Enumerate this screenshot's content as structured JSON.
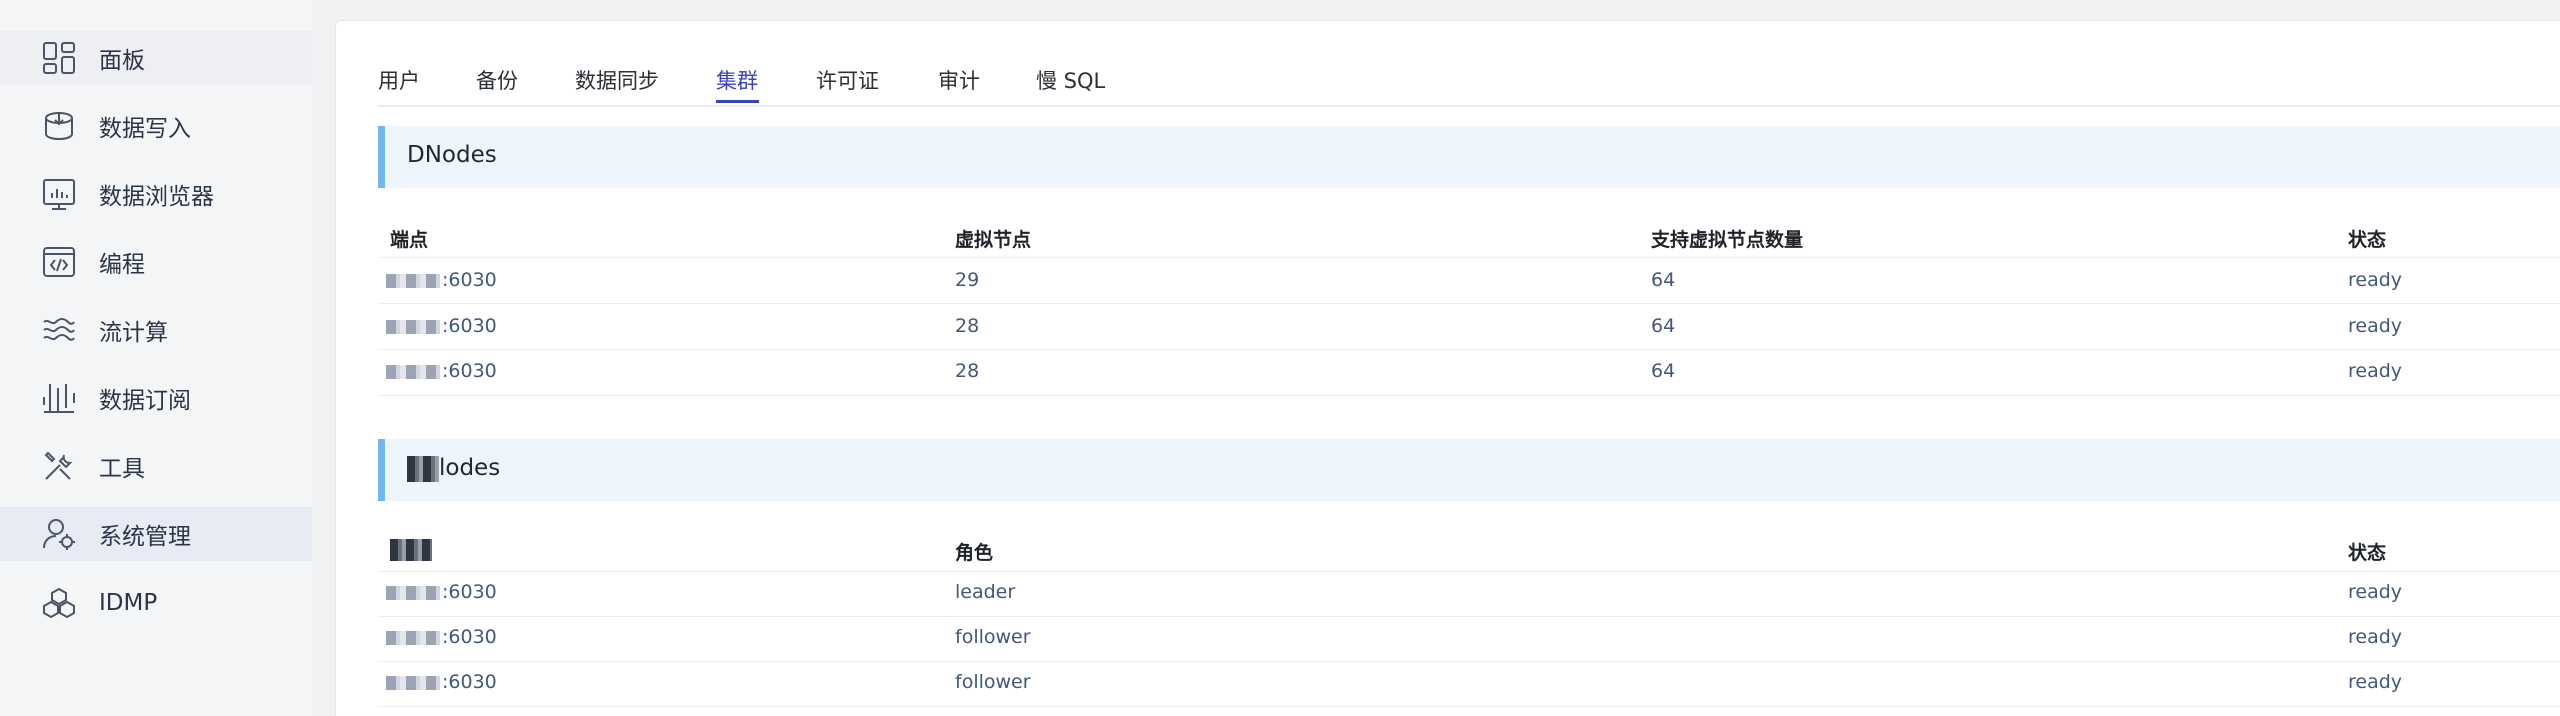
{
  "sidebar": {
    "items": [
      {
        "label": "面板",
        "icon": "dashboard-icon"
      },
      {
        "label": "数据写入",
        "icon": "data-ingest-icon"
      },
      {
        "label": "数据浏览器",
        "icon": "data-browser-icon"
      },
      {
        "label": "编程",
        "icon": "code-icon"
      },
      {
        "label": "流计算",
        "icon": "stream-icon"
      },
      {
        "label": "数据订阅",
        "icon": "subscribe-icon"
      },
      {
        "label": "工具",
        "icon": "tools-icon"
      },
      {
        "label": "系统管理",
        "icon": "admin-icon"
      },
      {
        "label": "IDMP",
        "icon": "idmp-icon"
      }
    ]
  },
  "tabs": [
    {
      "label": "用户"
    },
    {
      "label": "备份"
    },
    {
      "label": "数据同步"
    },
    {
      "label": "集群"
    },
    {
      "label": "许可证"
    },
    {
      "label": "审计"
    },
    {
      "label": "慢 SQL"
    }
  ],
  "dnodes": {
    "title": "DNodes",
    "headers": {
      "endpoint": "端点",
      "vnodes": "虚拟节点",
      "supported_vnodes": "支持虚拟节点数量",
      "status": "状态"
    },
    "rows": [
      {
        "endpoint": ":6030",
        "vnodes": "29",
        "supported": "64",
        "status": "ready"
      },
      {
        "endpoint": ":6030",
        "vnodes": "28",
        "supported": "64",
        "status": "ready"
      },
      {
        "endpoint": ":6030",
        "vnodes": "28",
        "supported": "64",
        "status": "ready"
      }
    ]
  },
  "mnodes": {
    "title": "lodes",
    "headers": {
      "role": "角色",
      "status": "状态"
    },
    "rows": [
      {
        "endpoint": ":6030",
        "role": "leader",
        "status": "ready"
      },
      {
        "endpoint": ":6030",
        "role": "follower",
        "status": "ready"
      },
      {
        "endpoint": ":6030",
        "role": "follower",
        "status": "ready"
      }
    ]
  },
  "colors": {
    "accent": "#3a44b8",
    "section_bar": "#74b6ee",
    "section_bg": "#eef5fc",
    "link": "#44577a"
  }
}
